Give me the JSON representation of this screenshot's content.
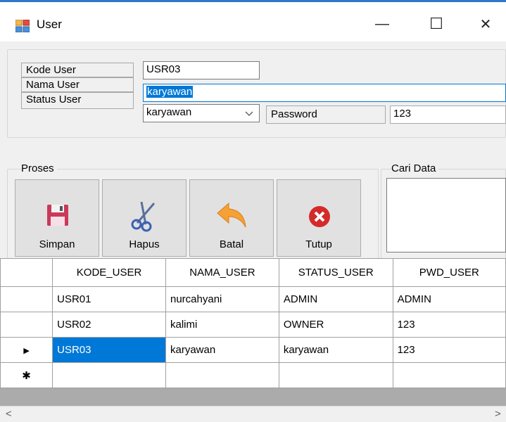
{
  "window": {
    "title": "User",
    "minimize_glyph": "—",
    "maximize_glyph": "☐",
    "close_glyph": "✕"
  },
  "form": {
    "kode_user_label": "Kode User",
    "kode_user_value": "USR03",
    "nama_user_label": "Nama User",
    "nama_user_value": "karyawan",
    "status_user_label": "Status User",
    "status_user_value": "karyawan",
    "password_label": "Password",
    "password_value": "123"
  },
  "proses": {
    "group_label": "Proses",
    "buttons": [
      {
        "label": "Simpan",
        "icon": "floppy-disk-icon"
      },
      {
        "label": "Hapus",
        "icon": "scissors-icon"
      },
      {
        "label": "Batal",
        "icon": "undo-arrow-icon"
      },
      {
        "label": "Tutup",
        "icon": "close-circle-icon"
      }
    ]
  },
  "cari": {
    "group_label": "Cari Data"
  },
  "grid": {
    "columns": [
      "KODE_USER",
      "NAMA_USER",
      "STATUS_USER",
      "PWD_USER"
    ],
    "rows": [
      [
        "USR01",
        "nurcahyani",
        "ADMIN",
        "ADMIN"
      ],
      [
        "USR02",
        "kalimi",
        "OWNER",
        "123"
      ],
      [
        "USR03",
        "karyawan",
        "karyawan",
        "123"
      ]
    ],
    "current_row_marker": "▶",
    "new_row_marker": "✱"
  },
  "scrollbar": {
    "left_glyph": "<",
    "right_glyph": ">"
  },
  "colors": {
    "selection": "#0078d7",
    "title_accent": "#2f78c8"
  }
}
